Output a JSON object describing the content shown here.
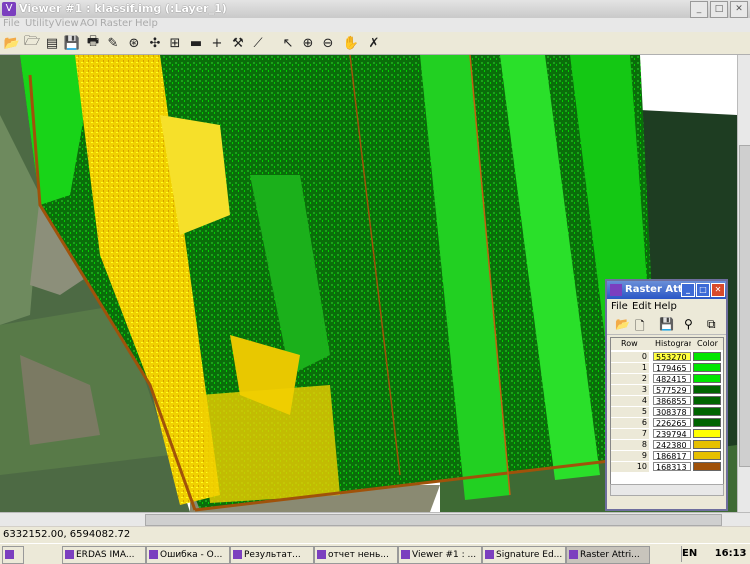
{
  "window": {
    "title": "Viewer #1 : klassif.img (:Layer_1)",
    "menu": [
      "File",
      "Utility",
      "View",
      "AOI",
      "Raster",
      "Help"
    ]
  },
  "toolbar": {
    "icons": [
      "open-icon",
      "open-layer-icon",
      "close-icon",
      "save-icon",
      "print-icon",
      "clear-icon",
      "info-icon",
      "fit-icon",
      "zoom-extent-icon",
      "ruler-icon",
      "crosshair-icon",
      "hammer-icon",
      "profile-icon",
      "select-arrow-icon",
      "zoom-in-icon",
      "zoom-out-icon",
      "pan-hand-icon",
      "inquire-icon"
    ]
  },
  "statusbar": {
    "coordinates": "6332152.00, 6594082.72"
  },
  "raster_window": {
    "title": "Raster Attri...",
    "menu": [
      "File",
      "Edit",
      "Help"
    ],
    "columns": [
      "Row",
      "Histogram",
      "Color"
    ],
    "rows": [
      {
        "row": "0",
        "histogram": "553270",
        "color": "#00e600"
      },
      {
        "row": "1",
        "histogram": "179465",
        "color": "#00e600"
      },
      {
        "row": "2",
        "histogram": "482415",
        "color": "#00e600"
      },
      {
        "row": "3",
        "histogram": "577529",
        "color": "#006400"
      },
      {
        "row": "4",
        "histogram": "386855",
        "color": "#006400"
      },
      {
        "row": "5",
        "histogram": "308378",
        "color": "#006400"
      },
      {
        "row": "6",
        "histogram": "226265",
        "color": "#006400"
      },
      {
        "row": "7",
        "histogram": "239794",
        "color": "#ffff00"
      },
      {
        "row": "8",
        "histogram": "242380",
        "color": "#e6c000"
      },
      {
        "row": "9",
        "histogram": "186817",
        "color": "#e6c000"
      },
      {
        "row": "10",
        "histogram": "168313",
        "color": "#a0520a"
      }
    ]
  },
  "taskbar": {
    "tasks": [
      {
        "label": "ERDAS IMA..."
      },
      {
        "label": "Ошибка - О..."
      },
      {
        "label": "Результат..."
      },
      {
        "label": "отчет нень..."
      },
      {
        "label": "Viewer #1 : ..."
      },
      {
        "label": "Signature Ed..."
      },
      {
        "label": "Raster Attri..."
      }
    ],
    "lang": "EN",
    "clock": "16:13"
  }
}
